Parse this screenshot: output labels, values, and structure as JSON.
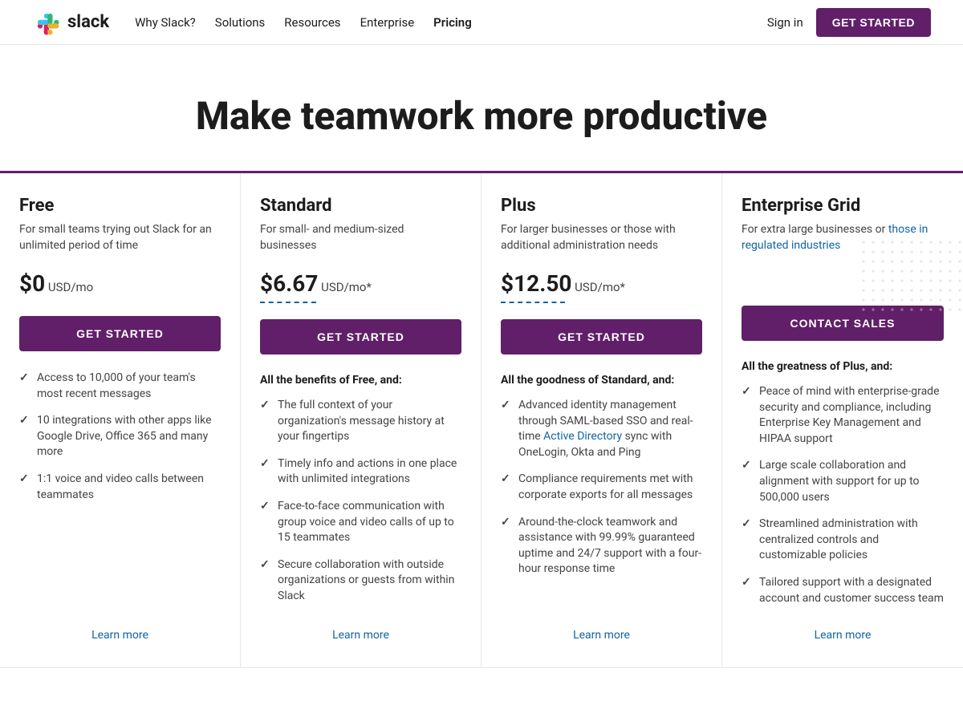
{
  "nav": {
    "logo_text": "slack",
    "links": [
      {
        "label": "Why Slack?",
        "id": "why-slack"
      },
      {
        "label": "Solutions",
        "id": "solutions"
      },
      {
        "label": "Resources",
        "id": "resources"
      },
      {
        "label": "Enterprise",
        "id": "enterprise"
      },
      {
        "label": "Pricing",
        "id": "pricing",
        "active": true
      }
    ],
    "sign_in": "Sign in",
    "get_started": "GET STARTED"
  },
  "hero": {
    "title": "Make teamwork more productive"
  },
  "plans": [
    {
      "id": "free",
      "name": "Free",
      "desc": "For small teams trying out Slack for an unlimited period of time",
      "price": "$0",
      "price_suffix": " USD/mo",
      "has_asterisk": false,
      "has_dashed_underline": false,
      "btn_label": "GET STARTED",
      "benefits_header": "",
      "benefits": [
        "Access to 10,000 of your team's most recent messages",
        "10 integrations with other apps like Google Drive, Office 365 and many more",
        "1:1 voice and video calls between teammates"
      ],
      "learn_more": "Learn more"
    },
    {
      "id": "standard",
      "name": "Standard",
      "desc": "For small- and medium-sized businesses",
      "price": "$6.67",
      "price_suffix": " USD/mo*",
      "has_asterisk": true,
      "has_dashed_underline": true,
      "btn_label": "GET STARTED",
      "benefits_header": "All the benefits of Free, and:",
      "benefits": [
        "The full context of your organization's message history at your fingertips",
        "Timely info and actions in one place with unlimited integrations",
        "Face-to-face communication with group voice and video calls of up to 15 teammates",
        "Secure collaboration with outside organizations or guests from within Slack"
      ],
      "learn_more": "Learn more"
    },
    {
      "id": "plus",
      "name": "Plus",
      "desc": "For larger businesses or those with additional administration needs",
      "price": "$12.50",
      "price_suffix": " USD/mo*",
      "has_asterisk": true,
      "has_dashed_underline": true,
      "btn_label": "GET STARTED",
      "benefits_header": "All the goodness of Standard, and:",
      "benefits": [
        "Advanced identity management through SAML-based SSO and real-time Active Directory sync with OneLogin, Okta and Ping",
        "Compliance requirements met with corporate exports for all messages",
        "Around-the-clock teamwork and assistance with 99.99% guaranteed uptime and 24/7 support with a four-hour response time"
      ],
      "learn_more": "Learn more"
    },
    {
      "id": "enterprise",
      "name": "Enterprise Grid",
      "desc_parts": [
        {
          "text": "For extra large businesses or "
        },
        {
          "text": "those in regulated industries",
          "link": true
        }
      ],
      "desc": "For extra large businesses or those in regulated industries",
      "price": "",
      "price_suffix": "",
      "has_asterisk": false,
      "has_dashed_underline": false,
      "btn_label": "CONTACT SALES",
      "benefits_header": "All the greatness of Plus, and:",
      "benefits": [
        "Peace of mind with enterprise-grade security and compliance, including Enterprise Key Management and HIPAA support",
        "Large scale collaboration and alignment with support for up to 500,000 users",
        "Streamlined administration with centralized controls and customizable policies",
        "Tailored support with a designated account and customer success team"
      ],
      "learn_more": "Learn more"
    }
  ]
}
